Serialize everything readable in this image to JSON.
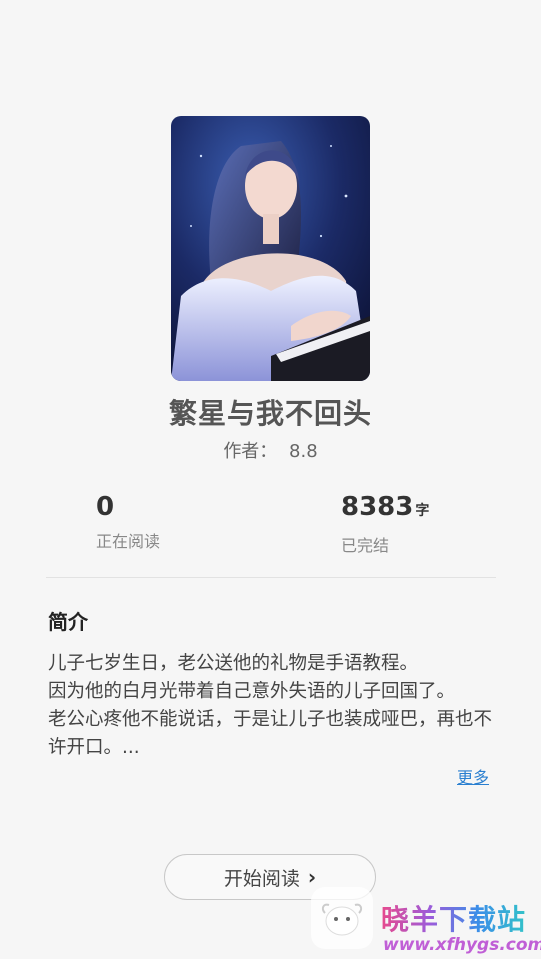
{
  "book": {
    "title": "繁星与我不回头",
    "author_label": "作者：",
    "author_value": "8.8",
    "cover_icon": "cover-image"
  },
  "stats": {
    "readers": {
      "value": "0",
      "label": "正在阅读"
    },
    "words": {
      "value": "8383",
      "unit": "字",
      "label": "已完结"
    }
  },
  "intro": {
    "heading": "简介",
    "text": "儿子七岁生日，老公送他的礼物是手语教程。\n因为他的白月光带着自己意外失语的儿子回国了。\n老公心疼他不能说话，于是让儿子也装成哑巴，再也不许开口。...",
    "more_label": "更多"
  },
  "actions": {
    "start_reading": "开始阅读",
    "start_icon": "chevron-right-icon"
  },
  "watermark": {
    "title": "晓羊下载站",
    "url": "www.xfhygs.com"
  }
}
